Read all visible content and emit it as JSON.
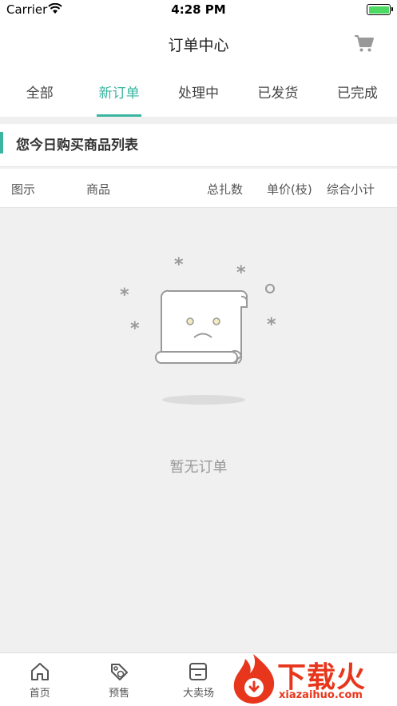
{
  "status_bar": {
    "carrier": "Carrier",
    "time": "4:28 PM"
  },
  "nav": {
    "title": "订单中心"
  },
  "tabs": [
    {
      "label": "全部"
    },
    {
      "label": "新订单"
    },
    {
      "label": "处理中"
    },
    {
      "label": "已发货"
    },
    {
      "label": "已完成"
    }
  ],
  "active_tab": "新订单",
  "section": {
    "title": "您今日购买商品列表"
  },
  "table_headers": {
    "image": "图示",
    "product": "商品",
    "total_count": "总扎数",
    "unit_price": "单价(枝)",
    "subtotal": "综合小计"
  },
  "empty_state": {
    "message": "暂无订单"
  },
  "bottom_tabs": [
    {
      "label": "首页",
      "icon": "home-icon"
    },
    {
      "label": "预售",
      "icon": "presale-tag-icon"
    },
    {
      "label": "大卖场",
      "icon": "store-icon"
    }
  ],
  "watermark": {
    "brand": "下载火",
    "site": "xiazaihuo.com"
  },
  "colors": {
    "accent": "#3bb5a0",
    "watermark": "#e8361c"
  }
}
